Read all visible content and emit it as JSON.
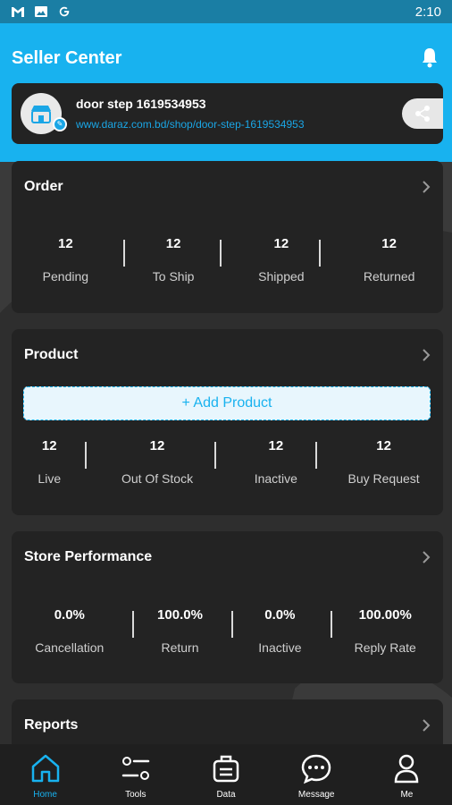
{
  "status_bar": {
    "time": "2:10",
    "icons": [
      "gmail-icon",
      "gallery-icon",
      "google-icon"
    ]
  },
  "header": {
    "title": "Seller Center",
    "bell_icon": "bell-icon",
    "accent_color": "#18b2ef"
  },
  "shop": {
    "name": "door step 1619534953",
    "url": "www.daraz.com.bd/shop/door-step-1619534953",
    "share_icon": "share-icon"
  },
  "order": {
    "title": "Order",
    "stats": [
      {
        "value": "12",
        "label": "Pending"
      },
      {
        "value": "12",
        "label": "To Ship"
      },
      {
        "value": "12",
        "label": "Shipped"
      },
      {
        "value": "12",
        "label": "Returned"
      }
    ]
  },
  "product": {
    "title": "Product",
    "add_button": "+ Add Product",
    "stats": [
      {
        "value": "12",
        "label": "Live"
      },
      {
        "value": "12",
        "label": "Out Of Stock"
      },
      {
        "value": "12",
        "label": "Inactive"
      },
      {
        "value": "12",
        "label": "Buy Request"
      }
    ]
  },
  "performance": {
    "title": "Store Performance",
    "stats": [
      {
        "value": "0.0%",
        "label": "Cancellation"
      },
      {
        "value": "100.0%",
        "label": "Return"
      },
      {
        "value": "0.0%",
        "label": "Inactive"
      },
      {
        "value": "100.00%",
        "label": "Reply Rate"
      }
    ]
  },
  "reports": {
    "title": "Reports"
  },
  "bottom_nav": [
    {
      "label": "Home",
      "icon": "home-icon",
      "active": true
    },
    {
      "label": "Tools",
      "icon": "tools-icon",
      "active": false
    },
    {
      "label": "Data",
      "icon": "data-icon",
      "active": false
    },
    {
      "label": "Message",
      "icon": "message-icon",
      "active": false
    },
    {
      "label": "Me",
      "icon": "profile-icon",
      "active": false
    }
  ]
}
